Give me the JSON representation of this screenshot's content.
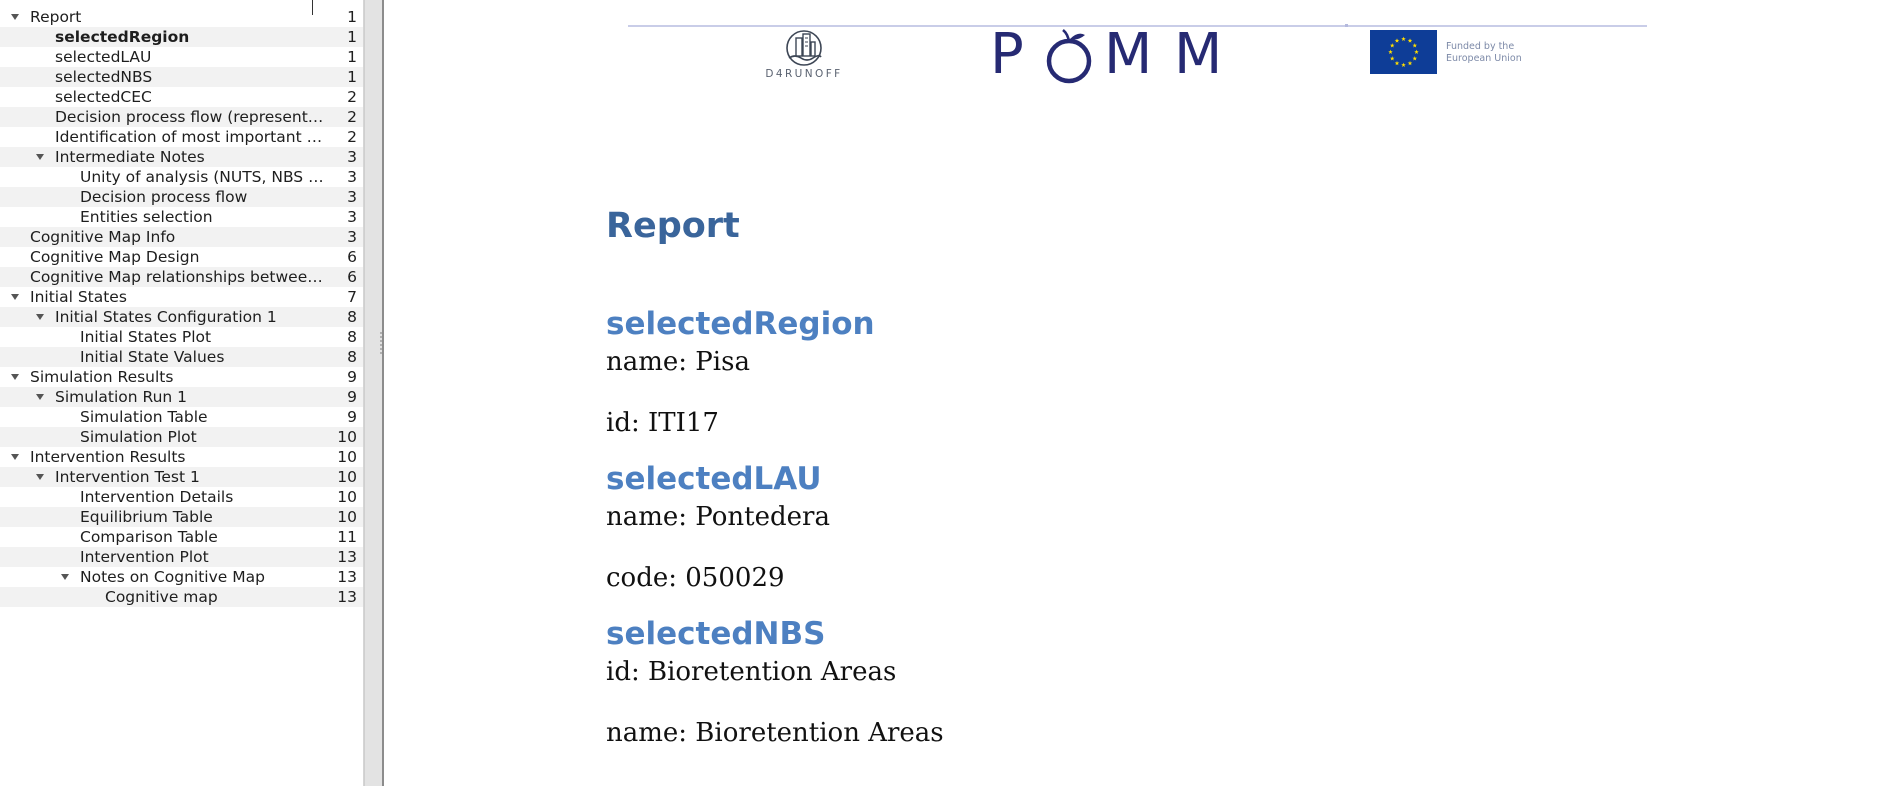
{
  "outline": {
    "items": [
      {
        "label": "Report",
        "page": "1",
        "level": 0,
        "expanded": true
      },
      {
        "label": "selectedRegion",
        "page": "1",
        "level": 1,
        "active": true
      },
      {
        "label": "selectedLAU",
        "page": "1",
        "level": 1
      },
      {
        "label": "selectedNBS",
        "page": "1",
        "level": 1
      },
      {
        "label": "selectedCEC",
        "page": "2",
        "level": 1
      },
      {
        "label": "Decision process flow (represented …",
        "page": "2",
        "level": 1
      },
      {
        "label": "Identification of most important en…",
        "page": "2",
        "level": 1
      },
      {
        "label": "Intermediate Notes",
        "page": "3",
        "level": 1,
        "expanded": true
      },
      {
        "label": "Unity of analysis (NUTS, NBS & C…",
        "page": "3",
        "level": 2
      },
      {
        "label": "Decision process flow",
        "page": "3",
        "level": 2
      },
      {
        "label": "Entities selection",
        "page": "3",
        "level": 2
      },
      {
        "label": "Cognitive Map Info",
        "page": "3",
        "level": 0
      },
      {
        "label": "Cognitive Map Design",
        "page": "6",
        "level": 0
      },
      {
        "label": "Cognitive Map relationships between e…",
        "page": "6",
        "level": 0
      },
      {
        "label": "Initial States",
        "page": "7",
        "level": 0,
        "expanded": true
      },
      {
        "label": "Initial States Configuration 1",
        "page": "8",
        "level": 1,
        "expanded": true
      },
      {
        "label": "Initial States Plot",
        "page": "8",
        "level": 2
      },
      {
        "label": "Initial State Values",
        "page": "8",
        "level": 2
      },
      {
        "label": "Simulation Results",
        "page": "9",
        "level": 0,
        "expanded": true
      },
      {
        "label": "Simulation Run 1",
        "page": "9",
        "level": 1,
        "expanded": true
      },
      {
        "label": "Simulation Table",
        "page": "9",
        "level": 2
      },
      {
        "label": "Simulation Plot",
        "page": "10",
        "level": 2
      },
      {
        "label": "Intervention Results",
        "page": "10",
        "level": 0,
        "expanded": true
      },
      {
        "label": "Intervention Test 1",
        "page": "10",
        "level": 1,
        "expanded": true
      },
      {
        "label": "Intervention Details",
        "page": "10",
        "level": 2
      },
      {
        "label": "Equilibrium Table",
        "page": "10",
        "level": 2
      },
      {
        "label": "Comparison Table",
        "page": "11",
        "level": 2
      },
      {
        "label": "Intervention Plot",
        "page": "13",
        "level": 2
      },
      {
        "label": "Notes on Cognitive Map",
        "page": "13",
        "level": 2,
        "expanded": true
      },
      {
        "label": "Cognitive map",
        "page": "13",
        "level": 3
      }
    ]
  },
  "header": {
    "d4runoff_logo_text": "D4RUNOFF",
    "pomm_logo_letters": [
      "P",
      "M",
      "M"
    ],
    "eu_caption_line1": "Funded by the",
    "eu_caption_line2": "European Union",
    "icons": {
      "d4runoff": "building-water-emblem-icon",
      "pomm": "apple-letter-o-icon",
      "eu": "eu-flag-icon"
    }
  },
  "document": {
    "title": "Report",
    "sections": {
      "selected_region": {
        "heading": "selectedRegion",
        "name": "name: Pisa",
        "id": "id: ITI17"
      },
      "selected_lau": {
        "heading": "selectedLAU",
        "name": "name: Pontedera",
        "code": "code: 050029"
      },
      "selected_nbs": {
        "heading": "selectedNBS",
        "id": "id: Bioretention Areas",
        "name": "name: Bioretention Areas"
      }
    }
  },
  "colors": {
    "title": "#3a659b",
    "heading": "#4d80c1",
    "pomm": "#262a73",
    "eu_flag": "#0e3d97",
    "eu_stars": "#ffdd00"
  }
}
